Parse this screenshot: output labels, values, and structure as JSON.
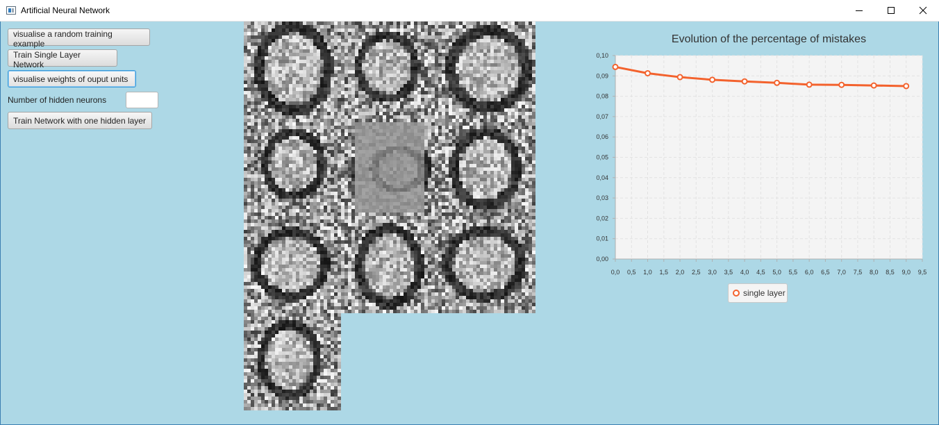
{
  "window": {
    "title": "Artificial Neural Network",
    "controls": [
      "minimize-icon",
      "maximize-icon",
      "close-icon"
    ]
  },
  "sidebar": {
    "visualise_example_label": "visualise a random training example",
    "train_single_label": "Train Single Layer Network",
    "visualise_weights_label": "visualise  weights of ouput units",
    "hidden_neurons_label": "Number of hidden neurons",
    "hidden_neurons_value": "",
    "train_hidden_label": "Train Network with one hidden layer"
  },
  "colors": {
    "background": "#add8e6",
    "series": "#f3622d",
    "plot_background": "#f4f4f4"
  },
  "chart_data": {
    "type": "line",
    "title": "Evolution of the percentage of mistakes",
    "xlabel": "",
    "ylabel": "",
    "xlim": [
      0,
      9.5
    ],
    "ylim": [
      0,
      0.1
    ],
    "x_ticks": [
      "0,0",
      "0,5",
      "1,0",
      "1,5",
      "2,0",
      "2,5",
      "3,0",
      "3,5",
      "4,0",
      "4,5",
      "5,0",
      "5,5",
      "6,0",
      "6,5",
      "7,0",
      "7,5",
      "8,0",
      "8,5",
      "9,0",
      "9,5"
    ],
    "y_ticks": [
      "0,00",
      "0,01",
      "0,02",
      "0,03",
      "0,04",
      "0,05",
      "0,06",
      "0,07",
      "0,08",
      "0,09",
      "0,10"
    ],
    "grid": true,
    "legend_position": "bottom",
    "series": [
      {
        "name": "single layer",
        "x": [
          0,
          1,
          2,
          3,
          4,
          5,
          6,
          7,
          8,
          9
        ],
        "y": [
          0.0944,
          0.0913,
          0.0894,
          0.0881,
          0.0873,
          0.0866,
          0.0857,
          0.0856,
          0.0853,
          0.085
        ]
      }
    ]
  }
}
